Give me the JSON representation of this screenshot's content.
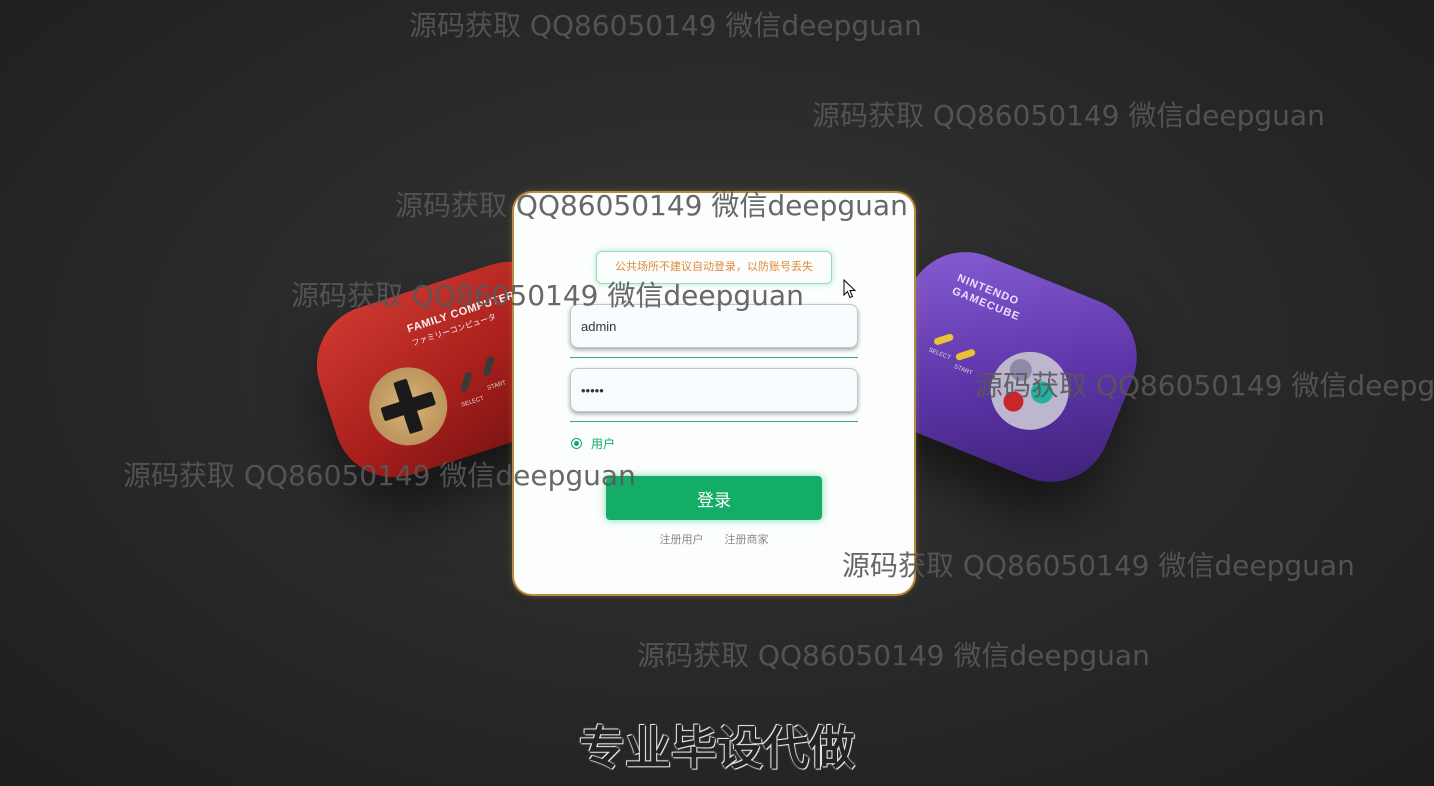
{
  "background": {
    "red_controller": {
      "brand": "FAMILY COMPUTER",
      "brand_sub": "ファミリーコンピュータ",
      "labels": [
        "SELECT",
        "START"
      ]
    },
    "purple_controller": {
      "brand_line1": "NINTENDO",
      "brand_line2": "GAMECUBE",
      "labels": [
        "SELECT",
        "START"
      ]
    }
  },
  "login": {
    "notice": "公共场所不建议自动登录，以防账号丢失",
    "username_value": "admin",
    "password_value": "admin",
    "role_label": "用户",
    "login_button": "登录",
    "register_user": "注册用户",
    "register_merchant": "注册商家"
  },
  "watermarks": [
    "源码获取 QQ86050149 微信deepguan",
    "源码获取 QQ86050149 微信deepguan",
    "源码获取 QQ86050149 微信deepguan",
    "源码获取 QQ86050149 微信deepguan",
    "源码获取 QQ86050149 微信deepguan",
    "源码获取 QQ86050149 微信deepguan",
    "源码获取 QQ86050149 微信deepguan",
    "源码获取 QQ86050149 微信deepguan"
  ],
  "banner": "专业毕设代做",
  "colors": {
    "accent": "#14ad68",
    "notice_text": "#e08a3c",
    "card_border": "#b98b3c"
  }
}
